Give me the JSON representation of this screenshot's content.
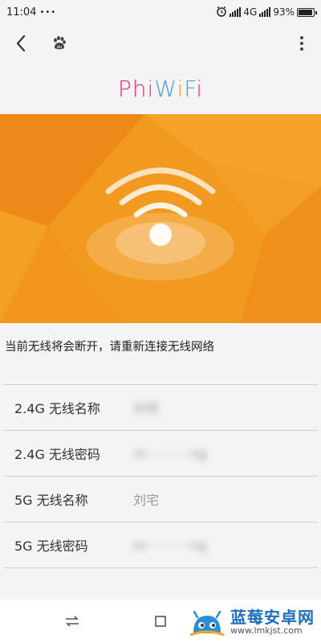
{
  "status_bar": {
    "time": "11:04",
    "dots": "•••",
    "network": "4G",
    "battery_percent": "93%",
    "battery_level": 0.93
  },
  "nav": {
    "back_icon": "chevron-left-icon",
    "site_icon": "baidu-paw-icon",
    "menu_icon": "more-vertical-icon"
  },
  "logo": {
    "part1": "Phi",
    "part2": "W",
    "part3": "i",
    "part4": "F",
    "part5": "i"
  },
  "notice": "当前无线将会断开，请重新连接无线网络",
  "settings": [
    {
      "label": "2.4G 无线名称",
      "value": "刘宅",
      "blurred": true
    },
    {
      "label": "2.4G 无线密码",
      "value": "m···········ng",
      "blurred": true
    },
    {
      "label": "5G 无线名称",
      "value": "刘宅",
      "blurred": false
    },
    {
      "label": "5G 无线密码",
      "value": "m···········ng",
      "blurred": true
    }
  ],
  "bottom_bar": {
    "switch_icon": "swap-arrows-icon",
    "square_icon": "square-icon"
  },
  "watermark": {
    "title": "蓝莓安卓网",
    "url": "www.lmkjst.com"
  },
  "colors": {
    "hero_orange": "#f39a1e",
    "hero_dark": "#e8760f",
    "logo_blue": "#4b9fdc",
    "logo_pink": "#e8327a"
  }
}
